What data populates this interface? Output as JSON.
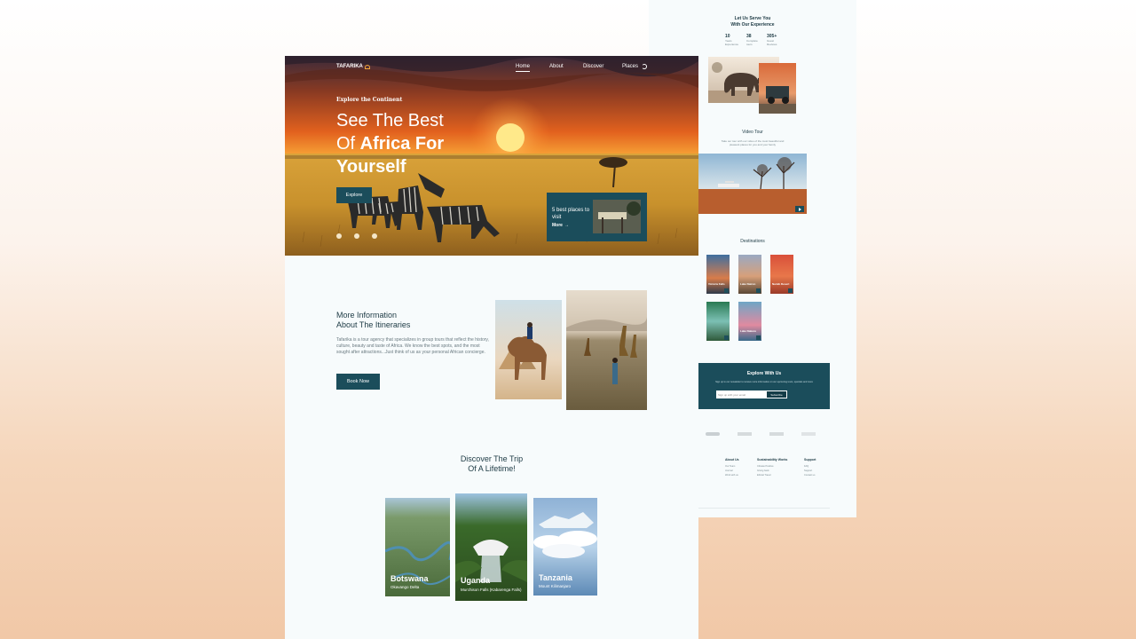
{
  "brand": {
    "logo": "TAFARIKA"
  },
  "nav": {
    "items": [
      "Home",
      "About",
      "Discover",
      "Places"
    ]
  },
  "hero": {
    "eyebrow": "Explore the Continent",
    "title_line1": "See The Best",
    "title_line2a": "Of ",
    "title_line2b": "Africa For",
    "title_line3": "Yourself",
    "cta": "Explore",
    "card_title": "5 best places to visit",
    "card_link": "More"
  },
  "info": {
    "heading_line1": "More Information",
    "heading_line2": "About The Itineraries",
    "body": "Tafarika is a tour agency that specializes in group tours that reflect the history, culture, beauty and taste of Africa. We know the best spots, and the most sought after attractions...Just think of us as your personal African concierge.",
    "cta": "Book Now"
  },
  "discover": {
    "heading_line1": "Discover The Trip",
    "heading_line2": "Of A Lifetime!",
    "cards": [
      {
        "name": "Botswana",
        "sub": "Okavango Delta"
      },
      {
        "name": "Uganda",
        "sub": "Murchison Falls (Kabarenga Falls)"
      },
      {
        "name": "Tanzania",
        "sub": "Mount Kilimanjaro"
      }
    ]
  },
  "back": {
    "serve_line1": "Let Us Serve You",
    "serve_line2": "With Our Experience",
    "stats": [
      {
        "num": "10",
        "label": "Years Experience"
      },
      {
        "num": "38",
        "label": "Complete tours"
      },
      {
        "num": "305+",
        "label": "Guest Reviews"
      }
    ],
    "video_heading": "Video Tour",
    "video_text": "Take our tour with our video of the most beautiful and pleasant places for you and your family",
    "destinations_heading": "Destinations",
    "explore_heading": "Explore With Us",
    "explore_text": "Sign up to our newsletter to receive more information on our upcoming tours, specials and more",
    "email_placeholder": "Sign up with your email",
    "subscribe": "Subscribe",
    "footer_cols": [
      {
        "title": "About Us",
        "items": [
          "Our Team",
          "Journal",
          "Work with us"
        ]
      },
      {
        "title": "Sustainability Works",
        "items": [
          "Climate Positive",
          "Giving back",
          "Ethical Travel"
        ]
      },
      {
        "title": "Support",
        "items": [
          "FAQ",
          "Support",
          "Contact us"
        ]
      }
    ]
  },
  "colors": {
    "primary": "#1b4d5b",
    "heading": "#1d3a44",
    "page_bg": "#f7fbfc",
    "sun": "#ffe98a"
  },
  "icons": [
    "logo-sun-icon",
    "moon-icon",
    "arrow-right-icon",
    "facebook-icon",
    "instagram-icon",
    "twitter-icon",
    "play-icon"
  ]
}
